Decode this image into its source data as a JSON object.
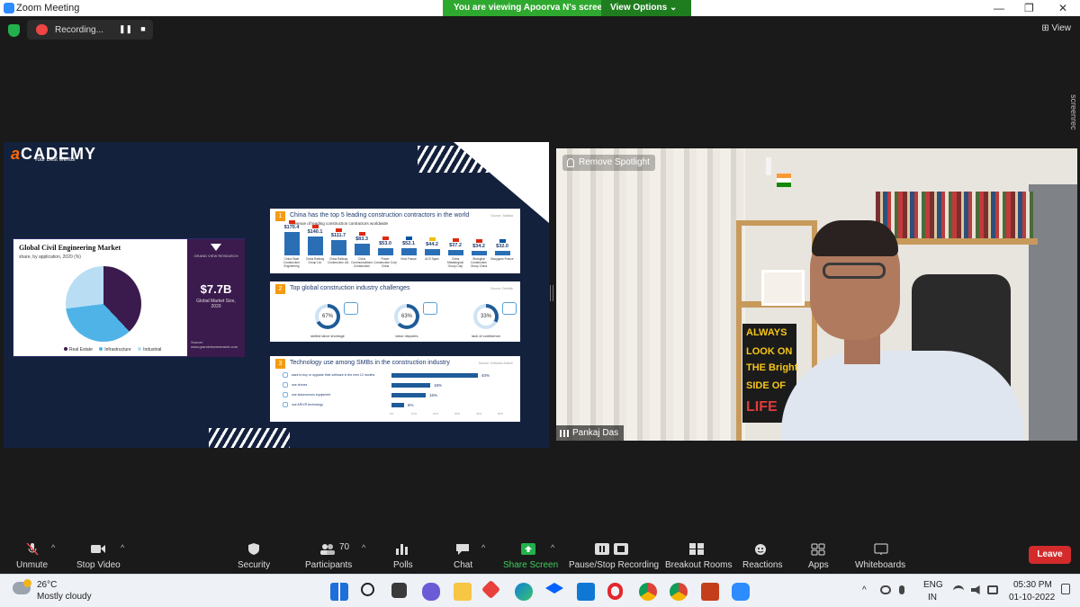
{
  "window": {
    "title": "Zoom Meeting",
    "banner_text": "You are viewing Apoorva N's screen",
    "view_options": "View Options ⌄"
  },
  "recording": {
    "label": "Recording...",
    "pause_glyph": "❚❚",
    "stop_glyph": "■"
  },
  "view_button": "⊞ View",
  "side_brand": "screenrec",
  "slide": {
    "brand": "CADEMY",
    "brand_mark": "a",
    "tagline": "Your Best Mentor",
    "market": {
      "title": "Global Civil Engineering Market",
      "subtitle": "share, by application, 2020 (%)",
      "legend": [
        "Real Estate",
        "Infrastructure",
        "Industrial"
      ],
      "colors": [
        "#3b1a4d",
        "#4fb3e8",
        "#b9ddf3"
      ],
      "shares": [
        38,
        35,
        27
      ],
      "publisher": "GRAND VIEW RESEARCH",
      "value": "$7.7B",
      "value_caption": "Global Market Size, 2020",
      "source": "Source: www.grandviewresearch.com"
    },
    "panel1": {
      "num": "1",
      "title": "China has the top 5 leading construction contractors in the world",
      "subtitle": "Revenue of leading construction contractors worldwide",
      "source": "Source: Statista",
      "bars": [
        {
          "value": "$170.4",
          "amount": 170.4,
          "name": "China State Construction Engineering",
          "flag": "#de2910"
        },
        {
          "value": "$140.1",
          "amount": 140.1,
          "name": "China Railway Group Ltd.",
          "flag": "#de2910"
        },
        {
          "value": "$111.7",
          "amount": 111.7,
          "name": "China Railway Construction Ltd.",
          "flag": "#de2910"
        },
        {
          "value": "$83.3",
          "amount": 83.3,
          "name": "China Communications Construction",
          "flag": "#de2910"
        },
        {
          "value": "$53.0",
          "amount": 53.0,
          "name": "Power Construction Corp China",
          "flag": "#de2910"
        },
        {
          "value": "$52.1",
          "amount": 52.1,
          "name": "Vinci France",
          "flag": "#0055a4"
        },
        {
          "value": "$44.2",
          "amount": 44.2,
          "name": "ACS Spain",
          "flag": "#f1bf00"
        },
        {
          "value": "$37.2",
          "amount": 37.2,
          "name": "China Metallurgical Group Corp",
          "flag": "#de2910"
        },
        {
          "value": "$34.2",
          "amount": 34.2,
          "name": "Shanghai Construction Group China",
          "flag": "#de2910"
        },
        {
          "value": "$32.0",
          "amount": 32.0,
          "name": "Bouygues France",
          "flag": "#0055a4"
        }
      ]
    },
    "panel2": {
      "num": "2",
      "title": "Top global construction industry challenges",
      "source": "Source: Deloitte",
      "items": [
        {
          "pct": "67%",
          "amount": 67,
          "label": "skilled labor shortage"
        },
        {
          "pct": "63%",
          "amount": 63,
          "label": "labor disputes"
        },
        {
          "pct": "33%",
          "amount": 33,
          "label": "lack of confidence"
        }
      ]
    },
    "panel3": {
      "num": "3",
      "title": "Technology use among SMBs in the construction industry",
      "source": "Source: Software Advice",
      "rows": [
        {
          "label": "want to buy or upgrade their software in the next 12 months",
          "pct": "40%",
          "amount": 40
        },
        {
          "label": "use drones",
          "pct": "18%",
          "amount": 18
        },
        {
          "label": "use autonomous equipment",
          "pct": "16%",
          "amount": 16
        },
        {
          "label": "use AR/VR technology",
          "pct": "6%",
          "amount": 6
        }
      ],
      "axis": [
        "0%",
        "10%",
        "20%",
        "30%",
        "40%",
        "50%"
      ]
    }
  },
  "video": {
    "spotlight": "Remove Spotlight",
    "participant": "Pankaj Das",
    "poster_lines": [
      "ALWAYS",
      "LOOK ON",
      "THE Bright",
      "SIDE OF",
      "LIFE"
    ]
  },
  "toolbar": {
    "unmute": "Unmute",
    "stop_video": "Stop Video",
    "security": "Security",
    "participants": "Participants",
    "participants_count": "70",
    "polls": "Polls",
    "chat": "Chat",
    "share_screen": "Share Screen",
    "pause_stop": "Pause/Stop Recording",
    "breakout": "Breakout Rooms",
    "reactions": "Reactions",
    "apps": "Apps",
    "whiteboards": "Whiteboards",
    "leave": "Leave"
  },
  "taskbar": {
    "temperature": "26°C",
    "weather": "Mostly cloudy",
    "lang_top": "ENG",
    "lang_bottom": "IN",
    "time": "05:30 PM",
    "date": "01-10-2022"
  }
}
